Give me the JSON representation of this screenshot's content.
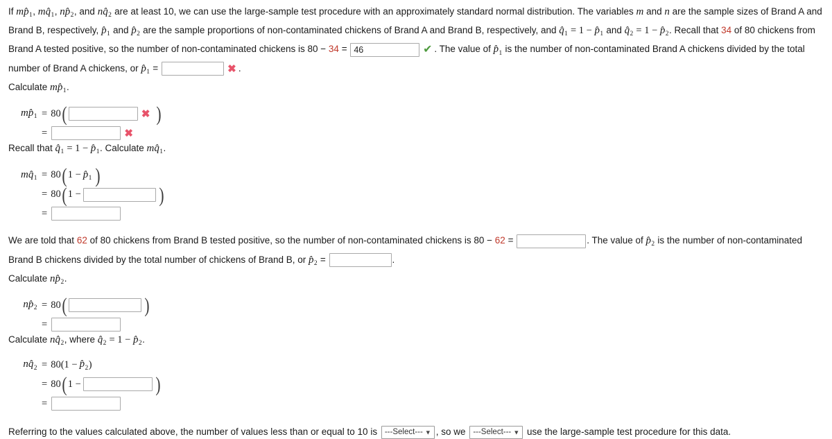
{
  "intro": {
    "part1": "If ",
    "t_mp1": "mp̂1",
    "sep1": ", ",
    "t_mq1": "mq̂1",
    "sep2": ", ",
    "t_np2": "np̂2",
    "sep3": ", and ",
    "t_nq2": "nq̂2",
    "part2": " are at least 10, we can use the large-sample test procedure with an approximately standard normal distribution. The variables ",
    "var_m": "m",
    "and1": " and ",
    "var_n": "n",
    "part3": " are the sample sizes of Brand A and Brand B, respectively, ",
    "p1": "p̂1",
    "and2": " and ",
    "p2": "p̂2",
    "part4": " are the sample proportions of non-contaminated chickens of Brand A and Brand B, respectively, and ",
    "q1": "q̂1",
    "eq1": " = 1 − ",
    "p1b": "p̂1",
    "and3": " and ",
    "q2": "q̂2",
    "eq2": " = 1 − ",
    "p2b": "p̂2",
    "part5": ". Recall that ",
    "num34": "34",
    "part6": " of 80 chickens from Brand A tested positive, so the number of non-contaminated chickens is 80 − ",
    "num34b": "34",
    "equals": " = ",
    "answer_46": "46",
    "part7": ". The value of ",
    "p1c": "p̂1",
    "part8": " is the number of non-contaminated Brand A chickens divided by the total number of Brand A chickens, or ",
    "p1d": "p̂1",
    "equals2": " = ",
    "period": "."
  },
  "inputs": {
    "brand_a_noncontaminated": "46",
    "p1_value": "",
    "mp1_inner": "",
    "mp1_result": "",
    "mq1_inner": "",
    "mq1_result": "",
    "brand_b_noncontaminated": "",
    "p2_value": "",
    "np2_inner": "",
    "np2_result": "",
    "nq2_inner": "",
    "nq2_result": ""
  },
  "marks": {
    "correct": "✔",
    "incorrect": "✖"
  },
  "sections": {
    "calc_mp1_label_pre": "Calculate ",
    "calc_mp1_label_sym": "mp̂1",
    "calc_mp1_label_post": ".",
    "mp1_lhs": "mp̂1",
    "coef_80": "80",
    "recall_q1_pre": "Recall that ",
    "recall_q1_sym": "q̂1",
    "recall_q1_mid": " = 1 − ",
    "recall_q1_p": "p̂1",
    "recall_q1_post": ". Calculate ",
    "recall_q1_target": "mq̂1",
    "recall_q1_end": ".",
    "mq1_lhs": "mq̂1",
    "one_minus": "1 −",
    "p1_inline": "p̂1",
    "calc_np2_label_pre": "Calculate ",
    "calc_np2_label_sym": "np̂2",
    "calc_np2_label_post": ".",
    "np2_lhs": "np̂2",
    "calc_nq2_label_pre": "Calculate ",
    "calc_nq2_label_sym": "nq̂2",
    "calc_nq2_label_mid": ", where ",
    "calc_nq2_label_q": "q̂2",
    "calc_nq2_label_eq": " = 1 − ",
    "calc_nq2_label_p": "p̂2",
    "calc_nq2_label_end": ".",
    "nq2_lhs": "nq̂2",
    "nq2_rhs_plain": "80(1 − p̂2)",
    "p2_inline": "p̂2"
  },
  "brand_b_paragraph": {
    "part1": "We are told that ",
    "num62": "62",
    "part2": " of 80 chickens from Brand B tested positive, so the number of non-contaminated chickens is 80 − ",
    "num62b": "62",
    "equals": " = ",
    "part3": ". The value of ",
    "p2": "p̂2",
    "part4": " is the number of non-contaminated Brand B chickens divided by the total number of chickens of Brand B, or ",
    "p2b": "p̂2",
    "equals2": " = ",
    "period": "."
  },
  "conclusion": {
    "part1": "Referring to the values calculated above, the number of values less than or equal to 10 is ",
    "select1_value": "---Select---",
    "part2": ", so we ",
    "select2_value": "---Select---",
    "part3": " use the large-sample test procedure for this data.",
    "chevron": "▼"
  },
  "colors": {
    "red_number": "#c0392b",
    "incorrect_mark": "#e8536a",
    "correct_mark": "#4e9a3e",
    "input_border": "#a9a9a9",
    "text": "#1a1a1a"
  }
}
